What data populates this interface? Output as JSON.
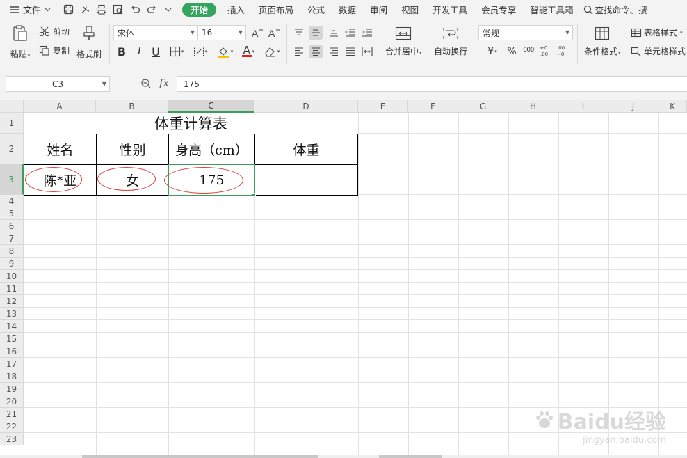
{
  "menu": {
    "file": "文件",
    "tabs": [
      "开始",
      "插入",
      "页面布局",
      "公式",
      "数据",
      "审阅",
      "视图",
      "开发工具",
      "会员专享",
      "智能工具箱"
    ],
    "search": "查找命令、搜"
  },
  "ribbon": {
    "paste": "粘贴",
    "cut": "剪切",
    "copy": "复制",
    "format_painter": "格式刷",
    "font_name": "宋体",
    "font_size": "16",
    "bold": "B",
    "italic": "I",
    "underline": "U",
    "font_color_glyph": "A",
    "merge_center": "合并居中",
    "wrap_text": "自动换行",
    "number_format": "常规",
    "currency": "¥",
    "percent": "%",
    "thousands": "000",
    "conditional_format": "条件格式",
    "table_style": "表格样式",
    "cell_style": "单元格样式"
  },
  "formula_bar": {
    "name_box": "C3",
    "fx": "fx",
    "value": "175"
  },
  "sheet": {
    "columns": [
      "A",
      "B",
      "C",
      "D",
      "E",
      "F",
      "G",
      "H",
      "I",
      "J",
      "K"
    ],
    "selected_column": "C",
    "selected_row": "3",
    "title": "体重计算表",
    "headers": [
      "姓名",
      "性别",
      "身高（cm）",
      "体重"
    ],
    "row3": [
      "陈*亚",
      "女",
      "175",
      ""
    ],
    "rows": [
      "1",
      "2",
      "3",
      "4",
      "5",
      "6",
      "7",
      "8",
      "9",
      "10",
      "11",
      "12",
      "13",
      "14",
      "15",
      "16",
      "17",
      "18",
      "19",
      "20",
      "21",
      "22",
      "23"
    ]
  },
  "watermark": {
    "brand": "Baidu经验",
    "url": "jingyan.baidu.com"
  },
  "colors": {
    "accent_green": "#35a45e",
    "selection_green": "#3c9e5c",
    "annotation_red": "#e03a3a"
  }
}
